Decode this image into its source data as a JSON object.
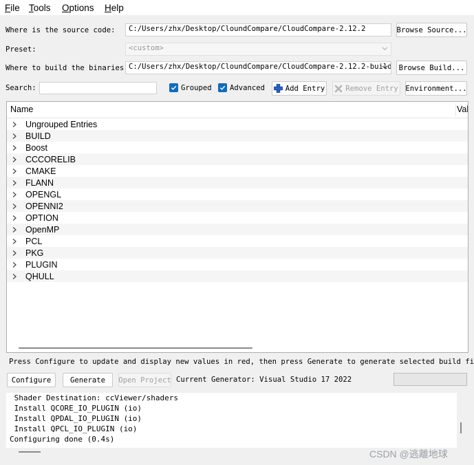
{
  "menu": {
    "items": [
      {
        "label": "File",
        "u": "F",
        "rest": "ile"
      },
      {
        "label": "Tools",
        "u": "T",
        "rest": "ools"
      },
      {
        "label": "Options",
        "u": "O",
        "rest": "ptions"
      },
      {
        "label": "Help",
        "u": "H",
        "rest": "elp"
      }
    ]
  },
  "source": {
    "label": "Where is the source code:",
    "value": "C:/Users/zhx/Desktop/CloundCompare/CloudCompare-2.12.2",
    "button": "Browse Source..."
  },
  "preset": {
    "label": "Preset:",
    "value": "<custom>"
  },
  "build": {
    "label": "Where to build the binaries:",
    "value": "C:/Users/zhx/Desktop/CloundCompare/CloudCompare-2.12.2-build",
    "button": "Browse Build..."
  },
  "search": {
    "label": "Search:",
    "value": "",
    "grouped_label": "Grouped",
    "advanced_label": "Advanced",
    "add_entry": "Add Entry",
    "remove_entry": "Remove Entry",
    "environment": "Environment..."
  },
  "tree": {
    "col_name": "Name",
    "col_value": "Val",
    "items": [
      "Ungrouped Entries",
      "BUILD",
      "Boost",
      "CCCORELIB",
      "CMAKE",
      "FLANN",
      "OPENGL",
      "OPENNI2",
      "OPTION",
      "OpenMP",
      "PCL",
      "PKG",
      "PLUGIN",
      "QHULL"
    ]
  },
  "status": {
    "message": "Press Configure to update and display new values in red, then press Generate to generate selected build files."
  },
  "actions": {
    "configure": "Configure",
    "generate": "Generate",
    "open_project": "Open Project",
    "generator": "Current Generator: Visual Studio 17 2022"
  },
  "log": {
    "lines": [
      " Shader Destination: ccViewer/shaders",
      " Install QCORE_IO_PLUGIN (io)",
      " Install QPDAL_IO_PLUGIN (io)",
      " Install QPCL_IO_PLUGIN (io)",
      "Configuring done (0.4s)"
    ]
  },
  "watermark": "CSDN @逃離地球",
  "colors": {
    "accent": "#0f6cbd",
    "background": "#f0f0f0"
  }
}
